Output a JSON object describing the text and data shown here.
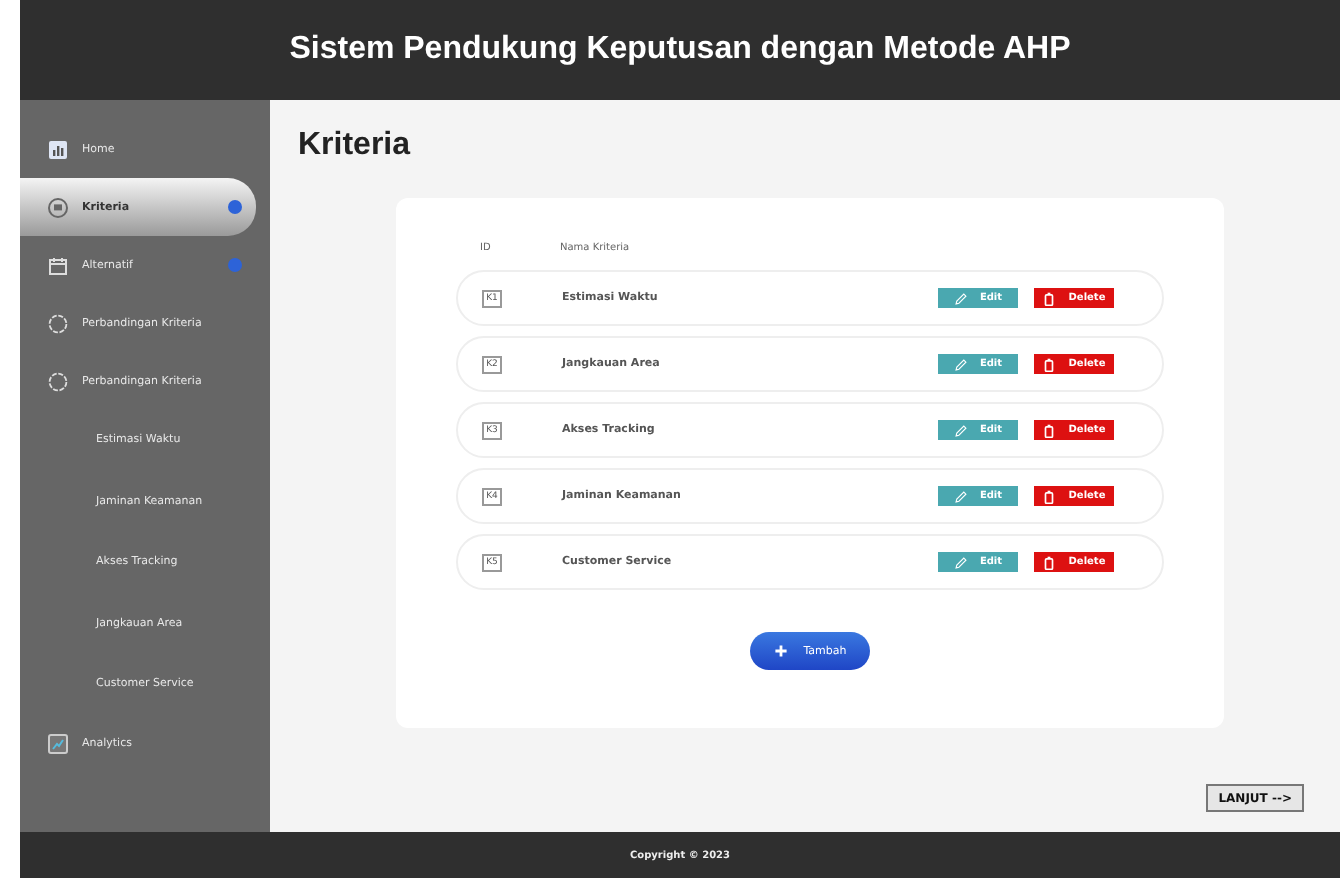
{
  "header": {
    "title": "Sistem Pendukung Keputusan dengan Metode AHP"
  },
  "sidebar": {
    "items": [
      {
        "kind": "item",
        "label": "Home",
        "selected": false,
        "badge": false
      },
      {
        "kind": "item",
        "label": "Kriteria",
        "selected": true,
        "badge": true
      },
      {
        "kind": "item",
        "label": "Alternatif",
        "selected": false,
        "badge": true
      },
      {
        "kind": "item",
        "label": "Perbandingan Kriteria",
        "selected": false,
        "badge": false
      },
      {
        "kind": "item",
        "label": "Perbandingan Kriteria",
        "selected": false,
        "badge": false
      },
      {
        "kind": "sub",
        "label": "Estimasi Waktu",
        "selected": false
      },
      {
        "kind": "sub",
        "label": "Jaminan Keamanan",
        "selected": false
      },
      {
        "kind": "sub",
        "label": "Akses Tracking",
        "selected": false
      },
      {
        "kind": "sub",
        "label": "Jangkauan Area",
        "selected": false
      },
      {
        "kind": "sub",
        "label": "Customer Service",
        "selected": false
      },
      {
        "kind": "item",
        "label": "Analytics",
        "selected": false,
        "badge": false
      }
    ]
  },
  "page_title": "Kriteria",
  "table": {
    "columns": [
      "ID",
      "Nama Kriteria"
    ],
    "rows": [
      {
        "id": "K1",
        "name": "Estimasi Waktu",
        "edit": "Edit",
        "delete": "Delete"
      },
      {
        "id": "K2",
        "name": "Jangkauan Area",
        "edit": "Edit",
        "delete": "Delete"
      },
      {
        "id": "K3",
        "name": "Akses Tracking",
        "edit": "Edit",
        "delete": "Delete"
      },
      {
        "id": "K4",
        "name": "Jaminan Keamanan",
        "edit": "Edit",
        "delete": "Delete"
      },
      {
        "id": "K5",
        "name": "Customer Service",
        "edit": "Edit",
        "delete": "Delete"
      }
    ]
  },
  "add_button": "Tambah",
  "next_button": "LANJUT -->",
  "footer": "Copyright © 2023"
}
